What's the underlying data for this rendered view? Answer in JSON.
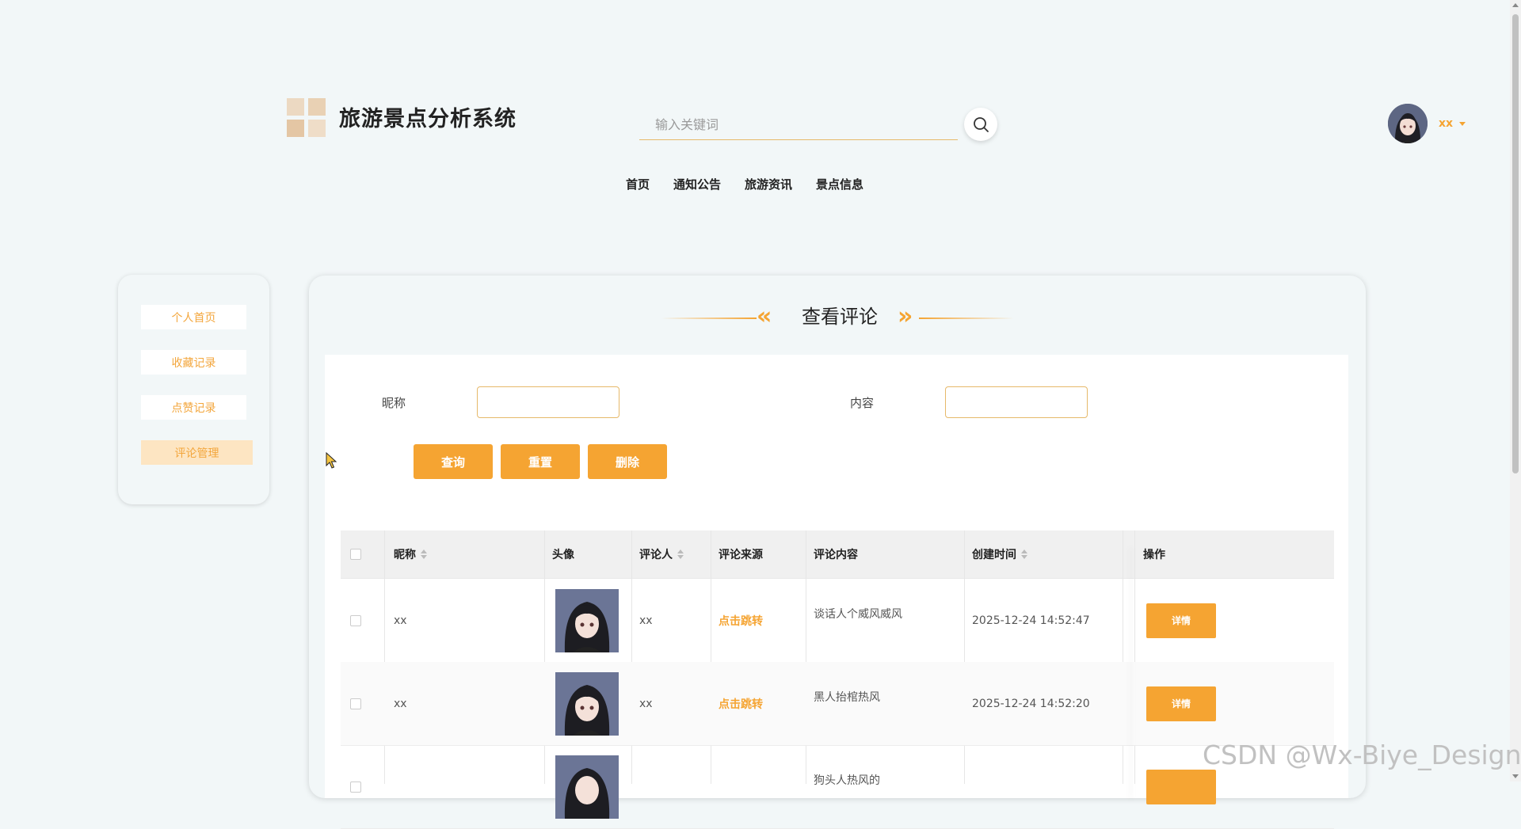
{
  "app": {
    "title": "旅游景点分析系统"
  },
  "search": {
    "placeholder": "输入关键词"
  },
  "user": {
    "name": "xx"
  },
  "nav": {
    "items": [
      "首页",
      "通知公告",
      "旅游资讯",
      "景点信息"
    ]
  },
  "sidebar": {
    "items": [
      {
        "label": "个人首页",
        "active": false
      },
      {
        "label": "收藏记录",
        "active": false
      },
      {
        "label": "点赞记录",
        "active": false
      },
      {
        "label": "评论管理",
        "active": true
      }
    ]
  },
  "page": {
    "title": "查看评论"
  },
  "filters": {
    "nickname_label": "昵称",
    "content_label": "内容",
    "nickname_value": "",
    "content_value": ""
  },
  "buttons": {
    "query": "查询",
    "reset": "重置",
    "delete": "删除"
  },
  "table": {
    "headers": {
      "nickname": "昵称",
      "avatar": "头像",
      "commenter": "评论人",
      "source": "评论来源",
      "content": "评论内容",
      "created": "创建时间",
      "actions": "操作"
    },
    "rows": [
      {
        "nickname": "xx",
        "commenter": "xx",
        "source": "点击跳转",
        "content": "谈话人个威风威风",
        "created": "2025-12-24 14:52:47",
        "action": "详情"
      },
      {
        "nickname": "xx",
        "commenter": "xx",
        "source": "点击跳转",
        "content": "黑人抬棺热风",
        "created": "2025-12-24 14:52:20",
        "action": "详情"
      },
      {
        "nickname": "",
        "commenter": "",
        "source": "",
        "content": "狗头人热风的",
        "created": "",
        "action": ""
      }
    ]
  },
  "watermark": "CSDN @Wx-Biye_Design",
  "colors": {
    "accent": "#f5a432",
    "background": "#f2f7f8",
    "active_side": "#fde5c2"
  }
}
